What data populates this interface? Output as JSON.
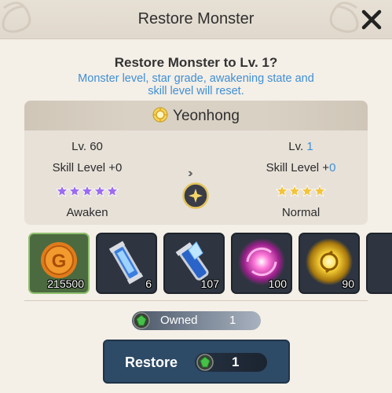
{
  "dialog": {
    "title": "Restore Monster",
    "question": "Restore Monster to Lv. 1?",
    "note": "Monster level, star grade, awakening state and skill level will reset."
  },
  "monster": {
    "name": "Yeonhong",
    "icon": "sun-attribute-icon"
  },
  "current": {
    "level": "Lv. 60",
    "skill": "Skill Level +0",
    "stars": 5,
    "star_color": "#9b6bf0",
    "state": "Awaken"
  },
  "after": {
    "level_prefix": "Lv. ",
    "level_value": "1",
    "skill_prefix": "Skill Level +",
    "skill_value": "0",
    "stars": 4,
    "star_color": "#f3c33a",
    "state": "Normal"
  },
  "transition_icon": "double-chevron-right-icon",
  "rewards": [
    {
      "icon": "gold-coin-icon",
      "count": "215500",
      "highlight": true
    },
    {
      "icon": "blue-potion-icon",
      "count": "6"
    },
    {
      "icon": "blue-crystal-potion-icon",
      "count": "107"
    },
    {
      "icon": "pink-swirl-orb-icon",
      "count": "100"
    },
    {
      "icon": "gold-swirl-orb-icon",
      "count": "90"
    }
  ],
  "owned": {
    "label": "Owned",
    "value": "1",
    "icon": "green-gem-icon"
  },
  "restore": {
    "label": "Restore",
    "cost": "1",
    "icon": "green-gem-icon"
  },
  "colors": {
    "accent_blue": "#3f8fd6",
    "button": "#2d4a66",
    "panel": "#e7e1d8"
  }
}
